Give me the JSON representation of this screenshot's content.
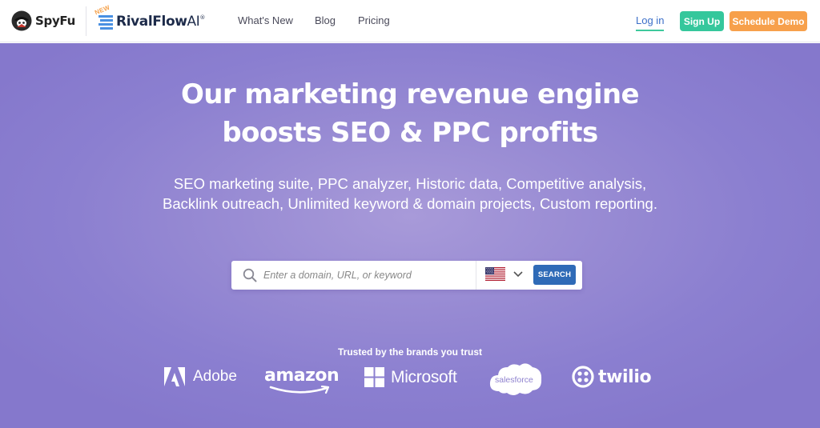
{
  "header": {
    "spyfu_logo": "SpyFu",
    "rivalflow_badge": "NEW",
    "rivalflow_logo_main": "RivalFlow",
    "rivalflow_logo_ai": "AI",
    "rivalflow_logo_reg": "®",
    "nav": {
      "whats_new": "What's New",
      "blog": "Blog",
      "pricing": "Pricing"
    },
    "login": "Log in",
    "signup": "Sign Up",
    "schedule_demo": "Schedule Demo"
  },
  "hero": {
    "title_line1": "Our marketing revenue engine",
    "title_line2": "boosts SEO & PPC profits",
    "subtitle": "SEO marketing suite, PPC analyzer, Historic data, Competitive analysis, Backlink outreach, Unlimited keyword & domain projects, Custom reporting."
  },
  "search": {
    "placeholder": "Enter a domain, URL, or keyword",
    "value": "",
    "country_icon": "us-flag-icon",
    "button": "SEARCH"
  },
  "trusted": {
    "label": "Trusted by the brands you trust",
    "brands": {
      "adobe": "Adobe",
      "amazon": "amazon",
      "microsoft": "Microsoft",
      "salesforce": "salesforce",
      "twilio": "twilio"
    }
  },
  "colors": {
    "hero_bg": "#978ad3",
    "signup_green": "#35c79c",
    "demo_orange": "#f7a04b",
    "search_blue": "#2f6bb7",
    "login_blue": "#3b6fc9"
  }
}
